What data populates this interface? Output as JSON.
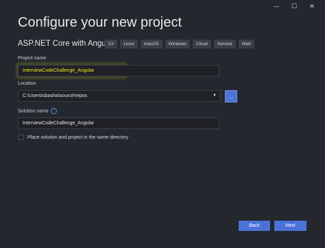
{
  "window": {
    "minimize_glyph": "—",
    "maximize_glyph": "☐",
    "close_glyph": "✕"
  },
  "header": {
    "title": "Configure your new project",
    "template_name": "ASP.NET Core with Angular",
    "tags": [
      "C#",
      "Linux",
      "macOS",
      "Windows",
      "Cloud",
      "Service",
      "Web"
    ]
  },
  "form": {
    "project_name_label": "Project name",
    "project_name_value": "InterviewCodeChallenge_Angular",
    "location_label": "Location",
    "location_value": "C:\\Users\\sbasha\\source\\repos",
    "browse_label": "...",
    "solution_name_label": "Solution name",
    "solution_name_value": "InterviewCodeChallenge_Angular",
    "same_directory_label": "Place solution and project in the same directory"
  },
  "footer": {
    "back_label": "Back",
    "next_label": "Next"
  },
  "colors": {
    "background": "#24272e",
    "accent": "#4a72d8",
    "highlight": "#f1e91a"
  }
}
